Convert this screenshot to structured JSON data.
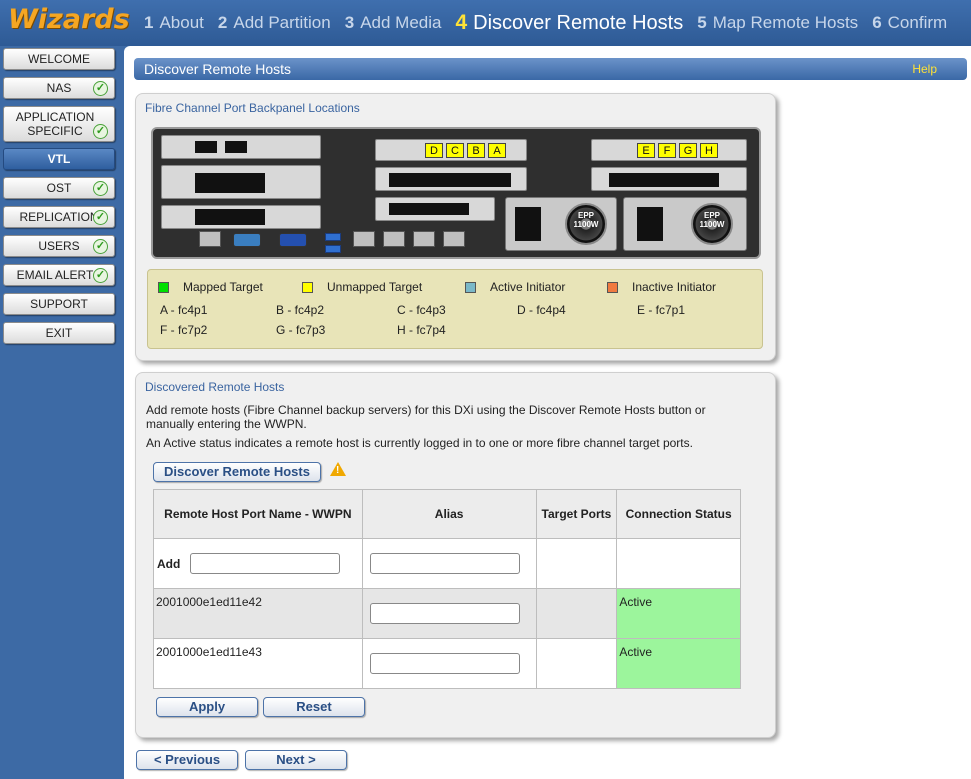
{
  "header": {
    "logo": "Wizards",
    "steps": [
      {
        "num": "1",
        "label": "About"
      },
      {
        "num": "2",
        "label": "Add Partition"
      },
      {
        "num": "3",
        "label": "Add Media"
      },
      {
        "num": "4",
        "label": "Discover Remote Hosts"
      },
      {
        "num": "5",
        "label": "Map Remote Hosts"
      },
      {
        "num": "6",
        "label": "Confirm"
      }
    ],
    "active_step": 4
  },
  "sidebar": {
    "items": [
      {
        "label": "WELCOME",
        "checked": false
      },
      {
        "label": "NAS",
        "checked": true
      },
      {
        "label": "APPLICATION SPECIFIC",
        "checked": true
      },
      {
        "label": "VTL",
        "checked": false,
        "active": true
      },
      {
        "label": "OST",
        "checked": true
      },
      {
        "label": "REPLICATION",
        "checked": true
      },
      {
        "label": "USERS",
        "checked": true
      },
      {
        "label": "EMAIL ALERTS",
        "checked": true
      },
      {
        "label": "SUPPORT",
        "checked": false
      },
      {
        "label": "EXIT",
        "checked": false
      }
    ]
  },
  "page": {
    "title": "Discover Remote Hosts",
    "help": "Help"
  },
  "backpanel": {
    "title": "Fibre Channel Port Backpanel Locations",
    "tags_left": [
      "D",
      "C",
      "B",
      "A"
    ],
    "tags_right": [
      "E",
      "F",
      "G",
      "H"
    ],
    "psu_label": "EPP",
    "psu_watt": "1100W"
  },
  "legend": {
    "items": [
      {
        "label": "Mapped Target",
        "color": "#00e000"
      },
      {
        "label": "Unmapped Target",
        "color": "#ffff00"
      },
      {
        "label": "Active Initiator",
        "color": "#7ab8c8"
      },
      {
        "label": "Inactive Initiator",
        "color": "#f07a40"
      }
    ],
    "ports": [
      "A - fc4p1",
      "B - fc4p2",
      "C - fc4p3",
      "D - fc4p4",
      "E - fc7p1",
      "F - fc7p2",
      "G - fc7p3",
      "H - fc7p4"
    ]
  },
  "discovered": {
    "title": "Discovered Remote Hosts",
    "para1": "Add remote hosts (Fibre Channel backup servers) for this DXi using the Discover Remote Hosts button or manually entering the WWPN.",
    "para2": "An Active status indicates a remote host is currently logged in to one or more fibre channel target ports.",
    "discover_button": "Discover Remote Hosts",
    "columns": [
      "Remote Host Port Name - WWPN",
      "Alias",
      "Target Ports",
      "Connection Status"
    ],
    "add_label": "Add",
    "rows": [
      {
        "wwpn": "2001000e1ed11e42",
        "alias": "",
        "target_ports": "",
        "status": "Active"
      },
      {
        "wwpn": "2001000e1ed11e43",
        "alias": "",
        "target_ports": "",
        "status": "Active"
      }
    ],
    "apply": "Apply",
    "reset": "Reset"
  },
  "footer": {
    "previous": "< Previous",
    "next": "Next >"
  }
}
